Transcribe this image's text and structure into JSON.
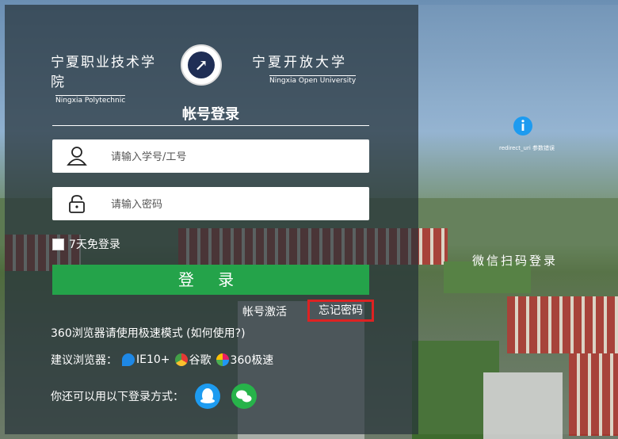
{
  "logo": {
    "left_cn": "宁夏职业技术学院",
    "left_en": "Ningxia Polytechnic",
    "right_cn": "宁夏开放大学",
    "right_en": "Ningxia Open University"
  },
  "title": "帐号登录",
  "username": {
    "placeholder": "请输入学号/工号",
    "value": ""
  },
  "password": {
    "placeholder": "请输入密码",
    "value": ""
  },
  "remember_label": "7天免登录",
  "login_button": "登 录",
  "links": {
    "activate": "帐号激活",
    "forgot": "忘记密码"
  },
  "tip": "360浏览器请使用极速模式 (如何使用?)",
  "browsers": {
    "label": "建议浏览器：",
    "ie": "IE10+",
    "chrome": "谷歌",
    "b360": "360极速"
  },
  "other_login_label": "你还可以用以下登录方式：",
  "qr": {
    "note": "redirect_uri 参数错误",
    "label": "微信扫码登录"
  },
  "colors": {
    "primary_green": "#24a34a",
    "highlight_red": "#d22222",
    "info_blue": "#1d9bf0"
  }
}
